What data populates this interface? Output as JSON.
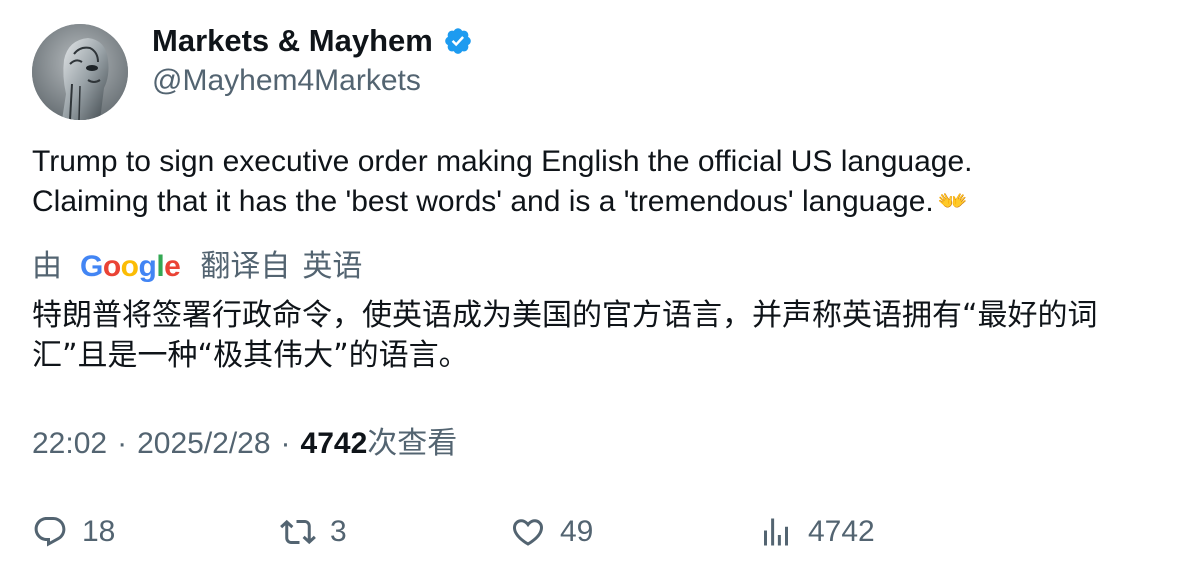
{
  "author": {
    "display_name": "Markets & Mayhem",
    "handle": "@Mayhem4Markets",
    "verified": true,
    "verified_color": "#1d9bf0",
    "avatar_icon": "robot-head-avatar"
  },
  "tweet": {
    "text_line1": "Trump to sign executive order making English the official US language.",
    "text_line2": "Claiming that it has the 'best words' and is a 'tremendous' language.",
    "emoji": "👐"
  },
  "translation": {
    "by_label": "由",
    "google_label": "Google",
    "from_label": "翻译自",
    "language": "英语",
    "text_line1": "特朗普将签署行政命令，使英语成为美国的官方语言，并声称英语拥有“最好的词",
    "text_line2": "汇”且是一种“极其伟大”的语言。"
  },
  "meta": {
    "time": "22:02",
    "separator": "·",
    "date": "2025/2/28",
    "views_count": "4742",
    "views_label": "次查看"
  },
  "actions": {
    "replies": "18",
    "retweets": "3",
    "likes": "49",
    "views": "4742"
  },
  "colors": {
    "text_primary": "#0f1419",
    "text_secondary": "#536471",
    "accent": "#1d9bf0"
  }
}
